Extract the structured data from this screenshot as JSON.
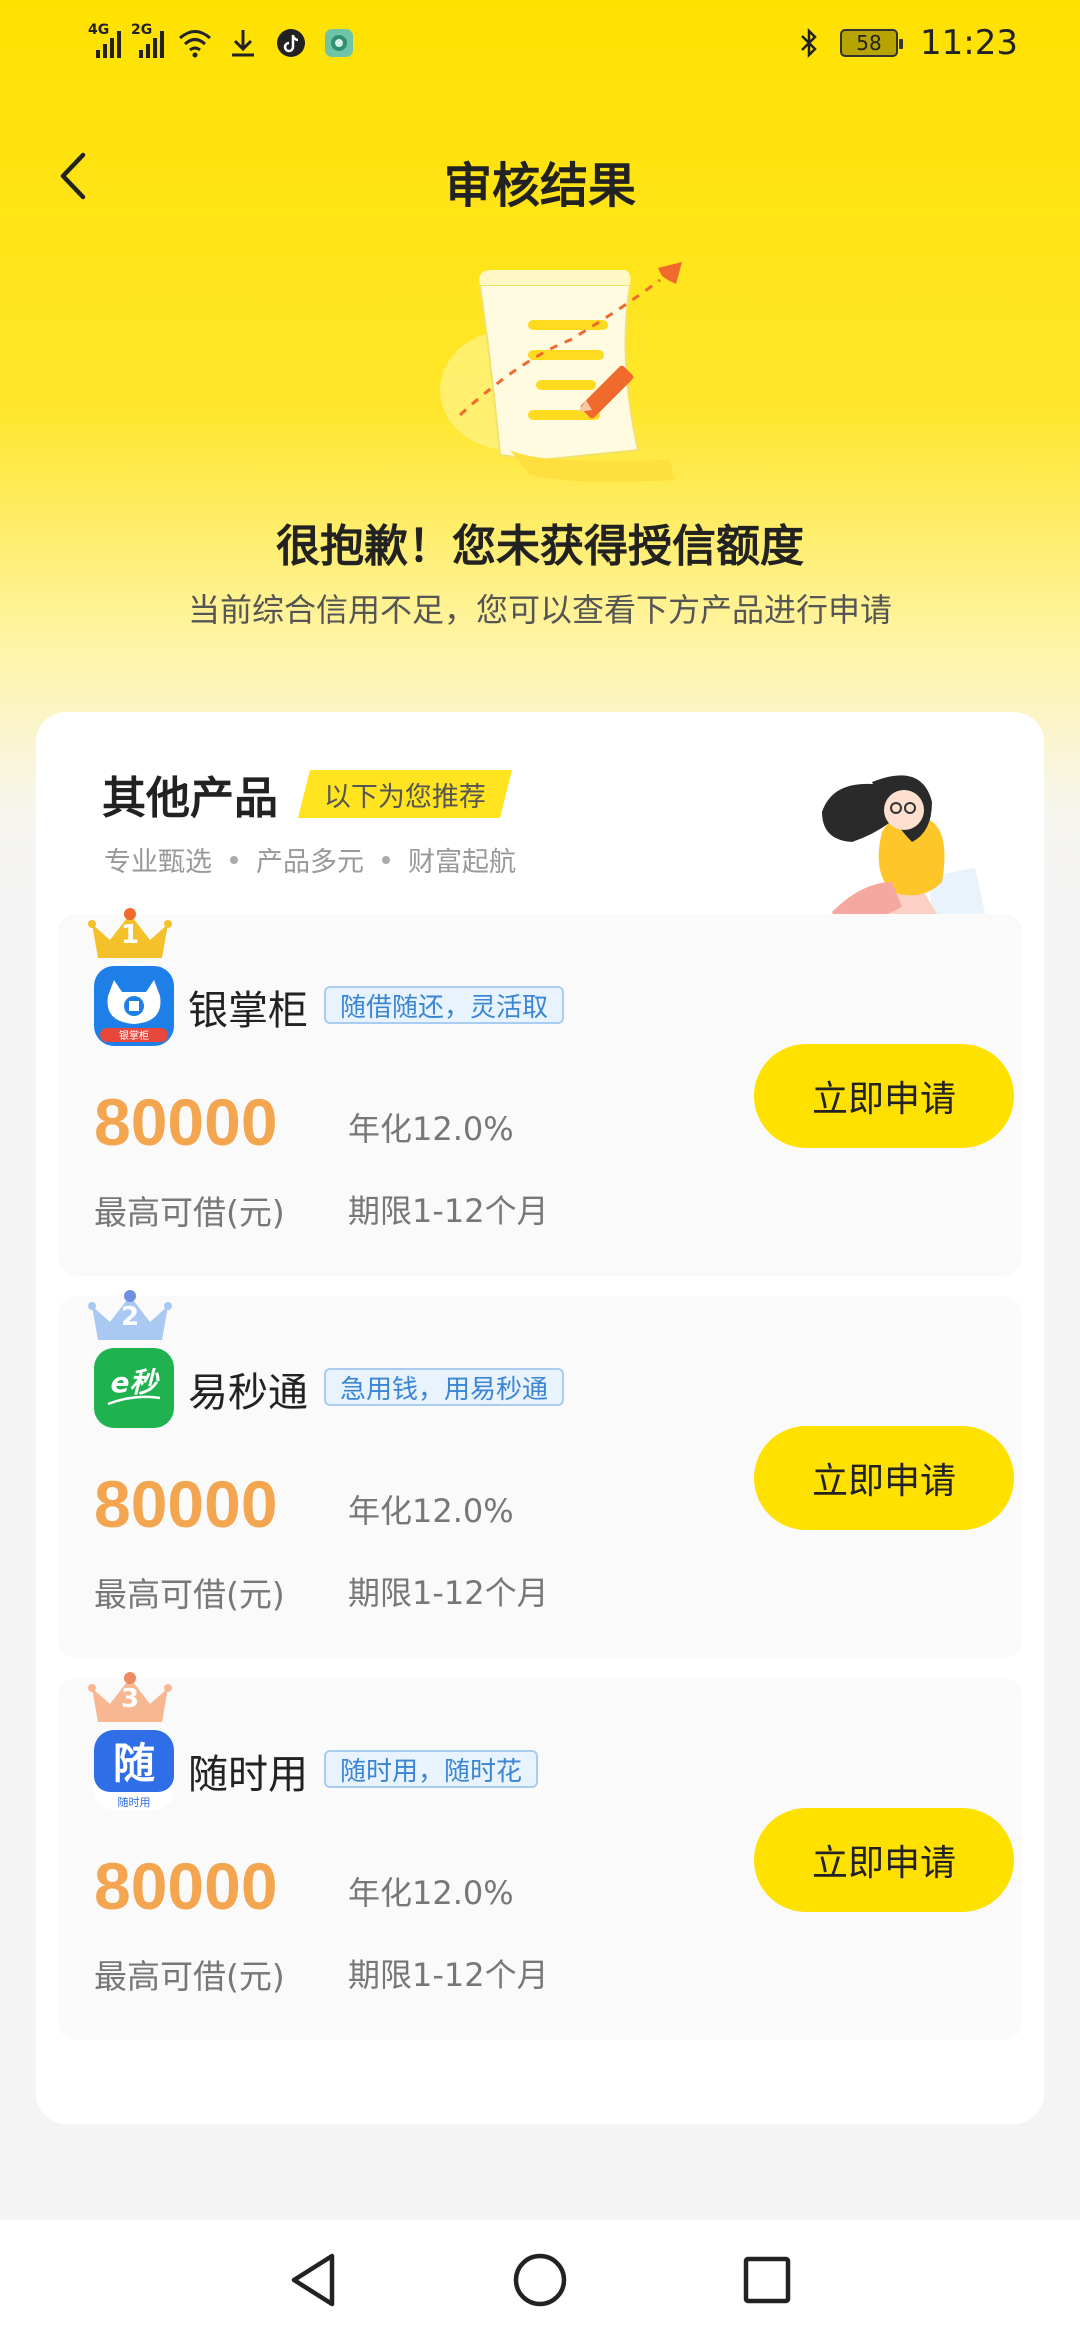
{
  "status_bar": {
    "network1": "4G",
    "network2": "2G",
    "battery": "58",
    "time": "11:23"
  },
  "header": {
    "title": "审核结果"
  },
  "result": {
    "title": "很抱歉！您未获得授信额度",
    "subtitle": "当前综合信用不足，您可以查看下方产品进行申请"
  },
  "section": {
    "title": "其他产品",
    "tag": "以下为您推荐",
    "sub1": "专业甄选",
    "sub2": "产品多元",
    "sub3": "财富起航"
  },
  "products": [
    {
      "rank": "1",
      "name": "银掌柜",
      "tag": "随借随还，灵活取",
      "logo_text": "银掌柜",
      "amount": "80000",
      "amount_label": "最高可借(元)",
      "rate": "年化12.0%",
      "term": "期限1-12个月",
      "button": "立即申请"
    },
    {
      "rank": "2",
      "name": "易秒通",
      "tag": "急用钱，用易秒通",
      "logo_text": "e秒",
      "amount": "80000",
      "amount_label": "最高可借(元)",
      "rate": "年化12.0%",
      "term": "期限1-12个月",
      "button": "立即申请"
    },
    {
      "rank": "3",
      "name": "随时用",
      "tag": "随时用，随时花",
      "logo_text": "随",
      "logo_sub": "随时用",
      "amount": "80000",
      "amount_label": "最高可借(元)",
      "rate": "年化12.0%",
      "term": "期限1-12个月",
      "button": "立即申请"
    }
  ],
  "colors": {
    "brand_yellow": "#ffe100",
    "amount_orange": "#f3a64f",
    "tag_blue": "#3a86d4",
    "crown_gold": "#f5c12b",
    "crown_blue": "#8fb7f0",
    "crown_peach": "#f5b08a"
  },
  "icons": [
    "back-arrow-icon",
    "bluetooth-icon",
    "wifi-icon",
    "download-icon",
    "tiktok-icon",
    "nav-back-icon",
    "nav-home-icon",
    "nav-recents-icon"
  ]
}
